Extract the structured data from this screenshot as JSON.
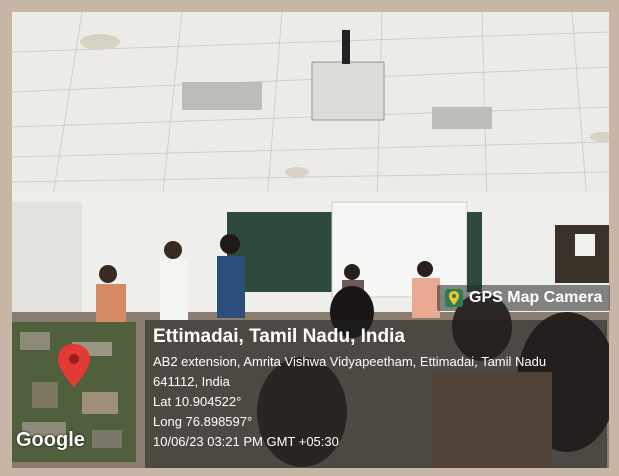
{
  "gps_tag": {
    "label": "GPS Map Camera"
  },
  "map": {
    "watermark": "Google"
  },
  "location": {
    "title": "Ettimadai, Tamil Nadu, India",
    "address_line1": "AB2 extension, Amrita Vishwa Vidyapeetham, Ettimadai, Tamil Nadu",
    "address_line2": "641112, India",
    "lat": "Lat 10.904522°",
    "long": "Long 76.898597°",
    "datetime": "10/06/23 03:21 PM GMT +05:30"
  }
}
